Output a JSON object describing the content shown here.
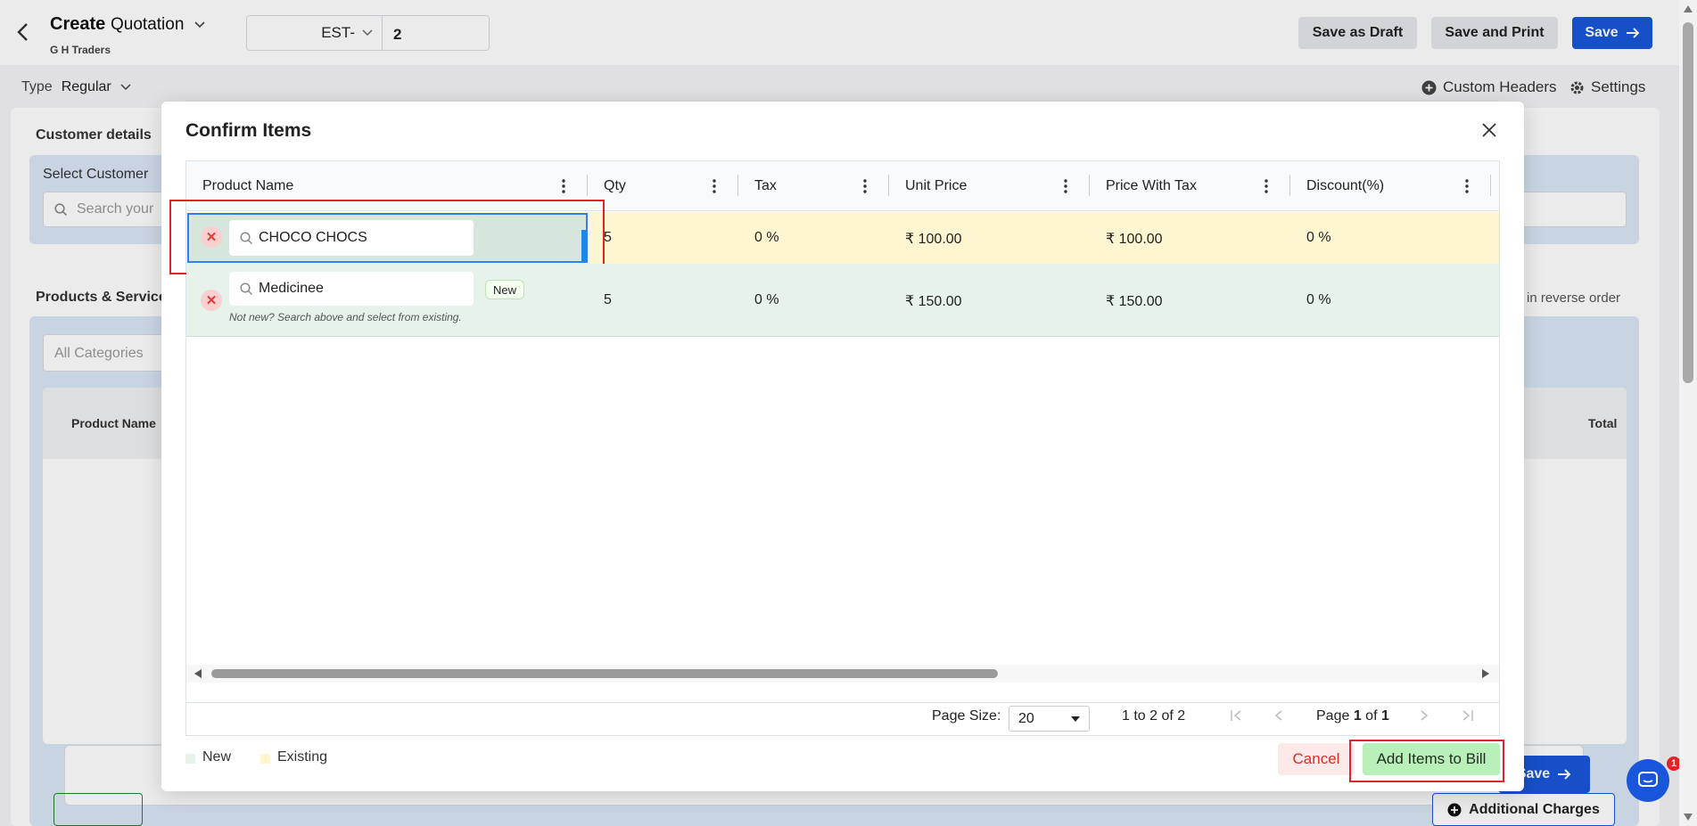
{
  "header": {
    "title": "Create",
    "doc_type": "Quotation",
    "company": "G H Traders",
    "estimate_prefix": "EST-",
    "estimate_number": "2",
    "save_draft": "Save as Draft",
    "save_print": "Save and Print",
    "save": "Save"
  },
  "typebar": {
    "label": "Type",
    "value": "Regular",
    "custom_headers": "Custom Headers",
    "settings": "Settings"
  },
  "background": {
    "customer_details": "Customer details",
    "select_customer": "Select Customer",
    "search_placeholder": "Search your",
    "products_services": "Products & Service",
    "reverse_order": "in reverse order",
    "all_categories": "All Categories",
    "col_product": "Product Name",
    "col_total": "Total",
    "save": "Save",
    "additional_charges": "Additional Charges",
    "chat_badge": "1"
  },
  "modal": {
    "title": "Confirm Items",
    "columns": [
      "Product Name",
      "Qty",
      "Tax",
      "Unit Price",
      "Price With Tax",
      "Discount(%)"
    ],
    "rows": [
      {
        "product": "CHOCO CHOCS",
        "qty": "5",
        "tax": "0 %",
        "unit_price": "₹ 100.00",
        "price_with_tax": "₹ 100.00",
        "discount": "0 %"
      },
      {
        "product": "Medicinee",
        "tag": "New",
        "hint": "Not new? Search above and select from existing.",
        "qty": "5",
        "tax": "0 %",
        "unit_price": "₹ 150.00",
        "price_with_tax": "₹ 150.00",
        "discount": "0 %"
      }
    ],
    "pagination": {
      "page_size_label": "Page Size:",
      "page_size": "20",
      "range_from": "1",
      "range_to": "2",
      "range_total": "2",
      "page_current": "1",
      "page_total": "1"
    },
    "legend": {
      "new": "New",
      "existing": "Existing",
      "new_color": "#e6f2ea",
      "existing_color": "#fdf6d0"
    },
    "cancel": "Cancel",
    "add_items": "Add Items to Bill"
  },
  "colors": {
    "primary": "#1a56db",
    "highlight": "#e02424"
  }
}
